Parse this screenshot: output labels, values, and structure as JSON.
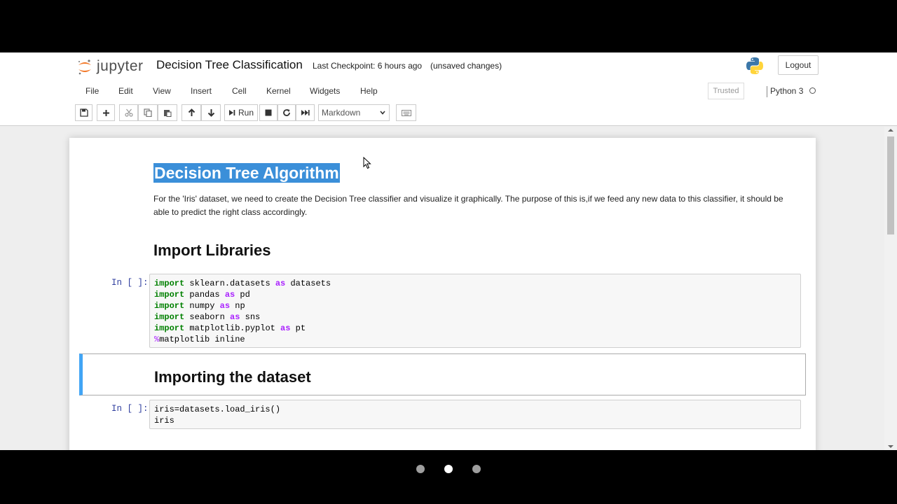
{
  "header": {
    "logo_text": "jupyter",
    "notebook_title": "Decision Tree Classification",
    "checkpoint": "Last Checkpoint: 6 hours ago",
    "unsaved": "(unsaved changes)",
    "logout_label": "Logout"
  },
  "menu": {
    "items": [
      "File",
      "Edit",
      "View",
      "Insert",
      "Cell",
      "Kernel",
      "Widgets",
      "Help"
    ],
    "trusted": "Trusted",
    "kernel": "Python 3"
  },
  "toolbar": {
    "run_label": "Run",
    "cell_type": "Markdown"
  },
  "cells": {
    "md1": {
      "title": "Decision Tree Algorithm",
      "paragraph": "For the 'Iris' dataset, we need to create the Decision Tree classifier and visualize it graphically. The purpose of this is,if we feed any new data to this classifier, it should be able to predict the right class accordingly."
    },
    "md2_title": "Import Libraries",
    "code1_prompt": "In [ ]:",
    "code1_lines": [
      {
        "kw": "import",
        "mid": " sklearn.datasets ",
        "kw2": "as",
        "end": " datasets"
      },
      {
        "kw": "import",
        "mid": " pandas ",
        "kw2": "as",
        "end": " pd"
      },
      {
        "kw": "import",
        "mid": " numpy ",
        "kw2": "as",
        "end": " np"
      },
      {
        "kw": "import",
        "mid": " seaborn ",
        "kw2": "as",
        "end": " sns"
      },
      {
        "kw": "import",
        "mid": " matplotlib.pyplot ",
        "kw2": "as",
        "end": " pt"
      }
    ],
    "code1_magic_pct": "%",
    "code1_magic": "matplotlib inline",
    "md3_title": "Importing the dataset",
    "code2_prompt": "In [ ]:",
    "code2_line1": "iris=datasets.load_iris()",
    "code2_line2": "iris"
  },
  "pager": {
    "count": 3,
    "active": 1
  },
  "colors": {
    "selection": "#3b8fd9",
    "cell_accent": "#42a5f5",
    "prompt": "#303f9f",
    "keyword": "#008000",
    "operator_keyword": "#aa22ff"
  }
}
